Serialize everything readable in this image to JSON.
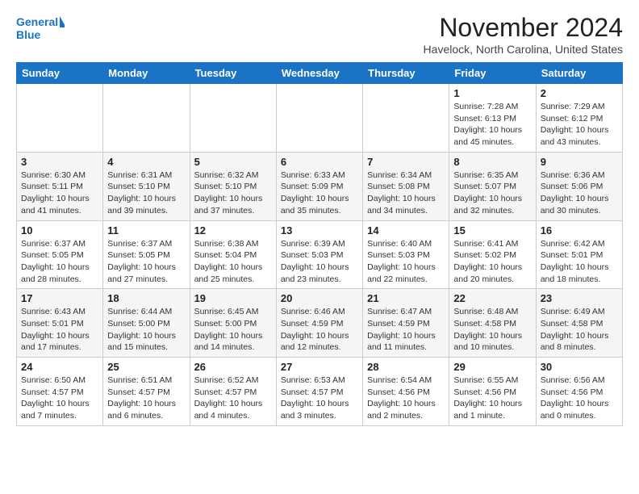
{
  "header": {
    "logo_line1": "General",
    "logo_line2": "Blue",
    "month": "November 2024",
    "location": "Havelock, North Carolina, United States"
  },
  "weekdays": [
    "Sunday",
    "Monday",
    "Tuesday",
    "Wednesday",
    "Thursday",
    "Friday",
    "Saturday"
  ],
  "weeks": [
    [
      {
        "day": "",
        "info": ""
      },
      {
        "day": "",
        "info": ""
      },
      {
        "day": "",
        "info": ""
      },
      {
        "day": "",
        "info": ""
      },
      {
        "day": "",
        "info": ""
      },
      {
        "day": "1",
        "info": "Sunrise: 7:28 AM\nSunset: 6:13 PM\nDaylight: 10 hours\nand 45 minutes."
      },
      {
        "day": "2",
        "info": "Sunrise: 7:29 AM\nSunset: 6:12 PM\nDaylight: 10 hours\nand 43 minutes."
      }
    ],
    [
      {
        "day": "3",
        "info": "Sunrise: 6:30 AM\nSunset: 5:11 PM\nDaylight: 10 hours\nand 41 minutes."
      },
      {
        "day": "4",
        "info": "Sunrise: 6:31 AM\nSunset: 5:10 PM\nDaylight: 10 hours\nand 39 minutes."
      },
      {
        "day": "5",
        "info": "Sunrise: 6:32 AM\nSunset: 5:10 PM\nDaylight: 10 hours\nand 37 minutes."
      },
      {
        "day": "6",
        "info": "Sunrise: 6:33 AM\nSunset: 5:09 PM\nDaylight: 10 hours\nand 35 minutes."
      },
      {
        "day": "7",
        "info": "Sunrise: 6:34 AM\nSunset: 5:08 PM\nDaylight: 10 hours\nand 34 minutes."
      },
      {
        "day": "8",
        "info": "Sunrise: 6:35 AM\nSunset: 5:07 PM\nDaylight: 10 hours\nand 32 minutes."
      },
      {
        "day": "9",
        "info": "Sunrise: 6:36 AM\nSunset: 5:06 PM\nDaylight: 10 hours\nand 30 minutes."
      }
    ],
    [
      {
        "day": "10",
        "info": "Sunrise: 6:37 AM\nSunset: 5:05 PM\nDaylight: 10 hours\nand 28 minutes."
      },
      {
        "day": "11",
        "info": "Sunrise: 6:37 AM\nSunset: 5:05 PM\nDaylight: 10 hours\nand 27 minutes."
      },
      {
        "day": "12",
        "info": "Sunrise: 6:38 AM\nSunset: 5:04 PM\nDaylight: 10 hours\nand 25 minutes."
      },
      {
        "day": "13",
        "info": "Sunrise: 6:39 AM\nSunset: 5:03 PM\nDaylight: 10 hours\nand 23 minutes."
      },
      {
        "day": "14",
        "info": "Sunrise: 6:40 AM\nSunset: 5:03 PM\nDaylight: 10 hours\nand 22 minutes."
      },
      {
        "day": "15",
        "info": "Sunrise: 6:41 AM\nSunset: 5:02 PM\nDaylight: 10 hours\nand 20 minutes."
      },
      {
        "day": "16",
        "info": "Sunrise: 6:42 AM\nSunset: 5:01 PM\nDaylight: 10 hours\nand 18 minutes."
      }
    ],
    [
      {
        "day": "17",
        "info": "Sunrise: 6:43 AM\nSunset: 5:01 PM\nDaylight: 10 hours\nand 17 minutes."
      },
      {
        "day": "18",
        "info": "Sunrise: 6:44 AM\nSunset: 5:00 PM\nDaylight: 10 hours\nand 15 minutes."
      },
      {
        "day": "19",
        "info": "Sunrise: 6:45 AM\nSunset: 5:00 PM\nDaylight: 10 hours\nand 14 minutes."
      },
      {
        "day": "20",
        "info": "Sunrise: 6:46 AM\nSunset: 4:59 PM\nDaylight: 10 hours\nand 12 minutes."
      },
      {
        "day": "21",
        "info": "Sunrise: 6:47 AM\nSunset: 4:59 PM\nDaylight: 10 hours\nand 11 minutes."
      },
      {
        "day": "22",
        "info": "Sunrise: 6:48 AM\nSunset: 4:58 PM\nDaylight: 10 hours\nand 10 minutes."
      },
      {
        "day": "23",
        "info": "Sunrise: 6:49 AM\nSunset: 4:58 PM\nDaylight: 10 hours\nand 8 minutes."
      }
    ],
    [
      {
        "day": "24",
        "info": "Sunrise: 6:50 AM\nSunset: 4:57 PM\nDaylight: 10 hours\nand 7 minutes."
      },
      {
        "day": "25",
        "info": "Sunrise: 6:51 AM\nSunset: 4:57 PM\nDaylight: 10 hours\nand 6 minutes."
      },
      {
        "day": "26",
        "info": "Sunrise: 6:52 AM\nSunset: 4:57 PM\nDaylight: 10 hours\nand 4 minutes."
      },
      {
        "day": "27",
        "info": "Sunrise: 6:53 AM\nSunset: 4:57 PM\nDaylight: 10 hours\nand 3 minutes."
      },
      {
        "day": "28",
        "info": "Sunrise: 6:54 AM\nSunset: 4:56 PM\nDaylight: 10 hours\nand 2 minutes."
      },
      {
        "day": "29",
        "info": "Sunrise: 6:55 AM\nSunset: 4:56 PM\nDaylight: 10 hours\nand 1 minute."
      },
      {
        "day": "30",
        "info": "Sunrise: 6:56 AM\nSunset: 4:56 PM\nDaylight: 10 hours\nand 0 minutes."
      }
    ]
  ]
}
